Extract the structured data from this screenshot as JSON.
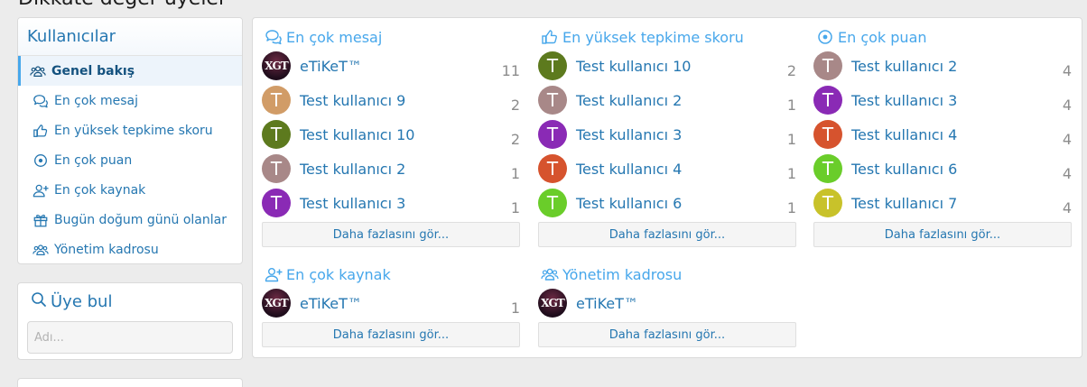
{
  "page": {
    "heading": "Dikkate değer üyeler"
  },
  "sidebar": {
    "title": "Kullanıcılar",
    "items": [
      {
        "label": "Genel bakış",
        "icon": "users-icon"
      },
      {
        "label": "En çok mesaj",
        "icon": "comments-icon"
      },
      {
        "label": "En yüksek tepkime skoru",
        "icon": "thumbs-up-icon"
      },
      {
        "label": "En çok puan",
        "icon": "dot-circle-icon"
      },
      {
        "label": "En çok kaynak",
        "icon": "user-plus-icon"
      },
      {
        "label": "Bugün doğum günü olanlar",
        "icon": "gift-icon"
      },
      {
        "label": "Yönetim kadrosu",
        "icon": "users-icon"
      }
    ]
  },
  "find_member": {
    "title": "Üye bul",
    "placeholder": "Adı..."
  },
  "sections": [
    {
      "title": "En çok mesaj",
      "icon": "comments-icon",
      "rows": [
        {
          "name": "eTiKeT™",
          "count": "11",
          "avatar": "XGT",
          "color": "#3a1428"
        },
        {
          "name": "Test kullanıcı 9",
          "count": "2",
          "avatar": "T",
          "color": "#d19c67"
        },
        {
          "name": "Test kullanıcı 10",
          "count": "2",
          "avatar": "T",
          "color": "#5d7a1e"
        },
        {
          "name": "Test kullanıcı 2",
          "count": "1",
          "avatar": "T",
          "color": "#a88888"
        },
        {
          "name": "Test kullanıcı 3",
          "count": "1",
          "avatar": "T",
          "color": "#8a2ab5"
        }
      ],
      "more": "Daha fazlasını gör..."
    },
    {
      "title": "En yüksek tepkime skoru",
      "icon": "thumbs-up-icon",
      "rows": [
        {
          "name": "Test kullanıcı 10",
          "count": "2",
          "avatar": "T",
          "color": "#5d7a1e"
        },
        {
          "name": "Test kullanıcı 2",
          "count": "1",
          "avatar": "T",
          "color": "#a88888"
        },
        {
          "name": "Test kullanıcı 3",
          "count": "1",
          "avatar": "T",
          "color": "#8a2ab5"
        },
        {
          "name": "Test kullanıcı 4",
          "count": "1",
          "avatar": "T",
          "color": "#d6532e"
        },
        {
          "name": "Test kullanıcı 6",
          "count": "1",
          "avatar": "T",
          "color": "#6acd2a"
        }
      ],
      "more": "Daha fazlasını gör..."
    },
    {
      "title": "En çok puan",
      "icon": "dot-circle-icon",
      "rows": [
        {
          "name": "Test kullanıcı 2",
          "count": "4",
          "avatar": "T",
          "color": "#a88888"
        },
        {
          "name": "Test kullanıcı 3",
          "count": "4",
          "avatar": "T",
          "color": "#8a2ab5"
        },
        {
          "name": "Test kullanıcı 4",
          "count": "4",
          "avatar": "T",
          "color": "#d6532e"
        },
        {
          "name": "Test kullanıcı 6",
          "count": "4",
          "avatar": "T",
          "color": "#6acd2a"
        },
        {
          "name": "Test kullanıcı 7",
          "count": "4",
          "avatar": "T",
          "color": "#c8c22a"
        }
      ],
      "more": "Daha fazlasını gör..."
    },
    {
      "title": "En çok kaynak",
      "icon": "user-plus-icon",
      "rows": [
        {
          "name": "eTiKeT™",
          "count": "1",
          "avatar": "XGT",
          "color": "#3a1428"
        }
      ],
      "more": "Daha fazlasını gör..."
    },
    {
      "title": "Yönetim kadrosu",
      "icon": "users-icon",
      "rows": [
        {
          "name": "eTiKeT™",
          "count": "",
          "avatar": "XGT",
          "color": "#3a1428"
        }
      ],
      "more": "Daha fazlasını gör..."
    }
  ],
  "colors": {
    "accent": "#47a7eb",
    "link": "#2577b1",
    "selected_bg": "#edf4fb"
  }
}
